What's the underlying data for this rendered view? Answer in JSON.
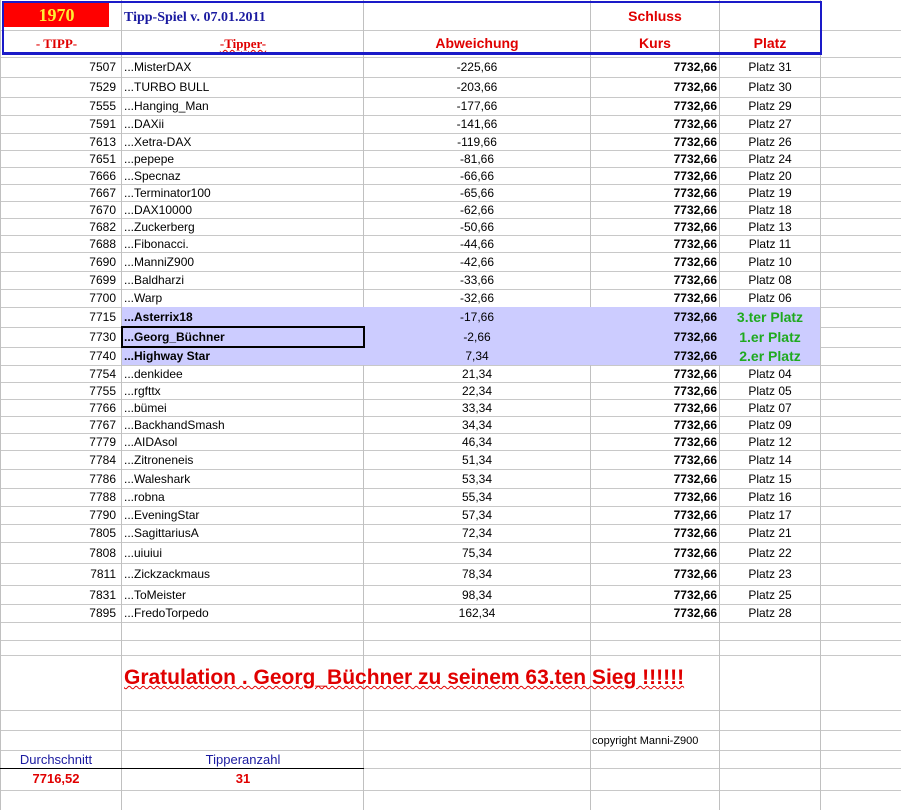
{
  "header": {
    "year": "1970",
    "title": "Tipp-Spiel v. 07.01.2011",
    "schluss": "Schluss",
    "col_tipp": "- TIPP-",
    "col_tipper": "-Tipper-",
    "col_abweichung": "Abweichung",
    "col_kurs": "Kurs",
    "col_platz": "Platz"
  },
  "rows": [
    [
      "7507",
      "...MisterDAX",
      "-225,66",
      "7732,66",
      "Platz 31"
    ],
    [
      "7529",
      "...TURBO BULL",
      "-203,66",
      "7732,66",
      "Platz 30"
    ],
    [
      "7555",
      "...Hanging_Man",
      "-177,66",
      "7732,66",
      "Platz 29"
    ],
    [
      "7591",
      "...DAXii",
      "-141,66",
      "7732,66",
      "Platz 27"
    ],
    [
      "7613",
      "...Xetra-DAX",
      "-119,66",
      "7732,66",
      "Platz 26"
    ],
    [
      "7651",
      "...pepepe",
      "-81,66",
      "7732,66",
      "Platz 24"
    ],
    [
      "7666",
      "...Specnaz",
      "-66,66",
      "7732,66",
      "Platz 20"
    ],
    [
      "7667",
      "...Terminator100",
      "-65,66",
      "7732,66",
      "Platz 19"
    ],
    [
      "7670",
      "...DAX10000",
      "-62,66",
      "7732,66",
      "Platz 18"
    ],
    [
      "7682",
      "...Zuckerberg",
      "-50,66",
      "7732,66",
      "Platz 13"
    ],
    [
      "7688",
      "...Fibonacci.",
      "-44,66",
      "7732,66",
      "Platz 11"
    ],
    [
      "7690",
      "...ManniZ900",
      "-42,66",
      "7732,66",
      "Platz 10"
    ],
    [
      "7699",
      "...Baldharzi",
      "-33,66",
      "7732,66",
      "Platz 08"
    ],
    [
      "7700",
      "...Warp",
      "-32,66",
      "7732,66",
      "Platz 06"
    ],
    [
      "7715",
      "...Asterrix18",
      "-17,66",
      "7732,66",
      "3.ter Platz"
    ],
    [
      "7730",
      "...Georg_Büchner",
      "-2,66",
      "7732,66",
      "1.er Platz"
    ],
    [
      "7740",
      "...Highway Star",
      "7,34",
      "7732,66",
      "2.er Platz"
    ],
    [
      "7754",
      "...denkidee",
      "21,34",
      "7732,66",
      "Platz 04"
    ],
    [
      "7755",
      "...rgfttx",
      "22,34",
      "7732,66",
      "Platz 05"
    ],
    [
      "7766",
      "...bümei",
      "33,34",
      "7732,66",
      "Platz 07"
    ],
    [
      "7767",
      "...BackhandSmash",
      "34,34",
      "7732,66",
      "Platz 09"
    ],
    [
      "7779",
      "...AIDAsol",
      "46,34",
      "7732,66",
      "Platz 12"
    ],
    [
      "7784",
      "...Zitroneneis",
      "51,34",
      "7732,66",
      "Platz 14"
    ],
    [
      "7786",
      "...Waleshark",
      "53,34",
      "7732,66",
      "Platz 15"
    ],
    [
      "7788",
      "...robna",
      "55,34",
      "7732,66",
      "Platz 16"
    ],
    [
      "7790",
      "...EveningStar",
      "57,34",
      "7732,66",
      "Platz 17"
    ],
    [
      "7805",
      "...SagittariusA",
      "72,34",
      "7732,66",
      "Platz 21"
    ],
    [
      "7808",
      "...uiuiui",
      "75,34",
      "7732,66",
      "Platz 22"
    ],
    [
      "7811",
      "...Zickzackmaus",
      "78,34",
      "7732,66",
      "Platz 23"
    ],
    [
      "7831",
      "...ToMeister",
      "98,34",
      "7732,66",
      "Platz 25"
    ],
    [
      "7895",
      "...FredoTorpedo",
      "162,34",
      "7732,66",
      "Platz 28"
    ]
  ],
  "footer": {
    "message": "Gratulation  . Georg_Büchner  zu seinem 63.ten Sieg !!!!!!",
    "copyright": "copyright Manni-Z900",
    "durchschnitt_label": "Durchschnitt",
    "durchschnitt_value": "7716,52",
    "tipperanzahl_label": "Tipperanzahl",
    "tipperanzahl_value": "31"
  },
  "colors": {
    "highlight": "#ccccff",
    "winner": "#1faa1f",
    "red": "#e00000",
    "blue": "#1a1aa0"
  }
}
